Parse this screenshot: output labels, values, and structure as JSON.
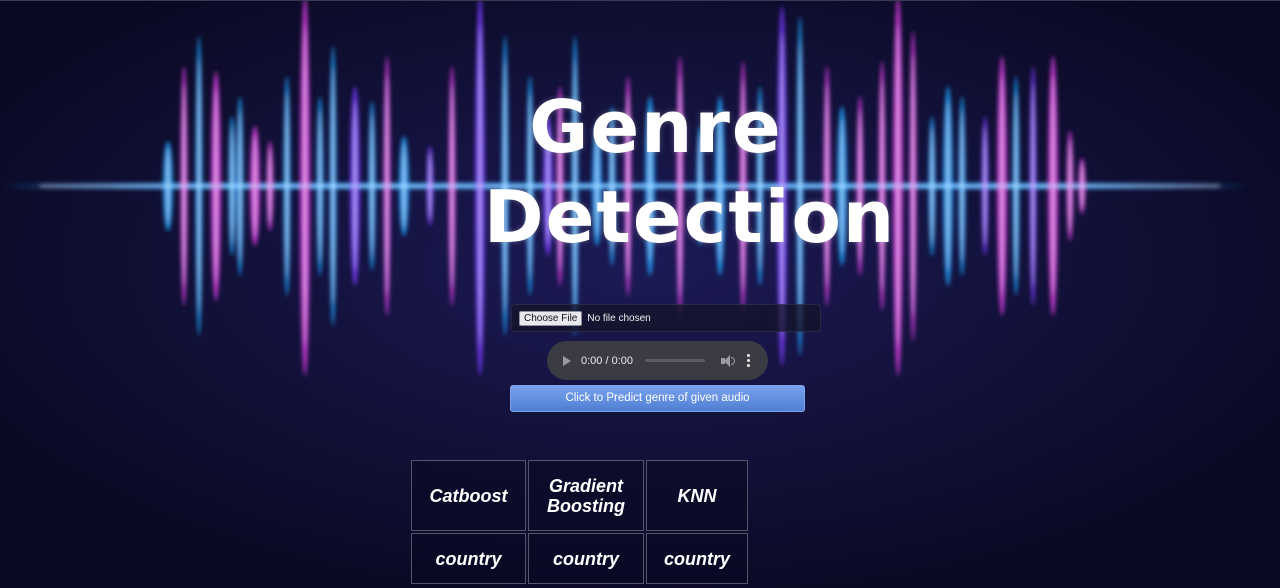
{
  "title": {
    "line1": "Genre",
    "line2": "Detection"
  },
  "file_input": {
    "button_label": "Choose File",
    "status": "No file chosen"
  },
  "audio_player": {
    "time": "0:00 / 0:00"
  },
  "predict_button": {
    "label": "Click to Predict genre of given audio"
  },
  "results_table": {
    "headers": [
      "Catboost",
      "Gradient Boosting",
      "KNN"
    ],
    "values": [
      "country",
      "country",
      "country"
    ]
  },
  "icons": [
    "play-icon",
    "volume-icon",
    "more-options-icon"
  ],
  "colors": {
    "background": "#0d0c2a",
    "wave_blue": "#1ea8ff",
    "wave_magenta": "#e040e8",
    "wave_purple": "#7a3cff",
    "button_blue": "#5f8ee0"
  }
}
